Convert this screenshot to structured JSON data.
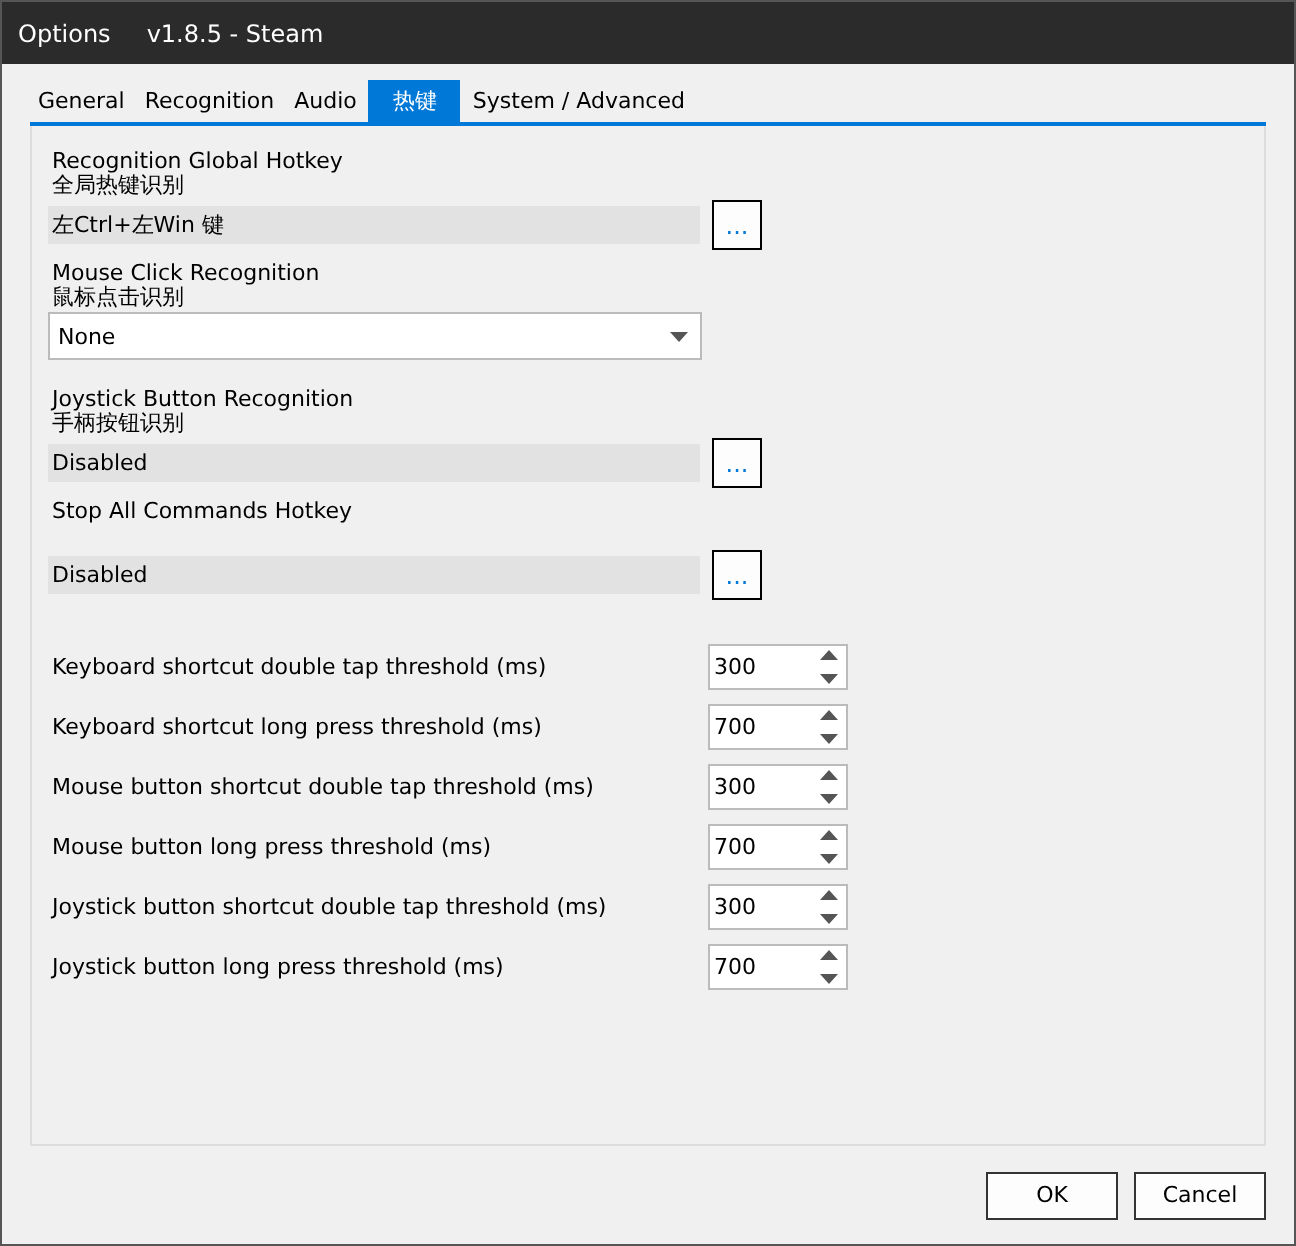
{
  "window": {
    "title": "Options",
    "version": "v1.8.5 - Steam"
  },
  "tabs": [
    {
      "label": "General",
      "selected": false
    },
    {
      "label": "Recognition",
      "selected": false
    },
    {
      "label": "Audio",
      "selected": false
    },
    {
      "label": "热键",
      "selected": true
    },
    {
      "label": "System / Advanced",
      "selected": false
    }
  ],
  "sections": [
    {
      "kind": "hotkey",
      "label": "Recognition Global Hotkey",
      "sublabel": "全局热键识别",
      "value": "左Ctrl+左Win 键",
      "button": "..."
    },
    {
      "kind": "dropdown",
      "label": "Mouse Click Recognition",
      "sublabel": "鼠标点击识别",
      "value": "None"
    },
    {
      "kind": "hotkey",
      "label": "Joystick Button Recognition",
      "sublabel": "手柄按钮识别",
      "value": "Disabled",
      "button": "..."
    },
    {
      "kind": "hotkey",
      "label": "Stop All Commands Hotkey",
      "value": "Disabled",
      "button": "..."
    }
  ],
  "thresholds": [
    {
      "label": "Keyboard shortcut double tap threshold (ms)",
      "value": "300"
    },
    {
      "label": "Keyboard shortcut long press threshold (ms)",
      "value": "700"
    },
    {
      "label": "Mouse button shortcut double tap threshold (ms)",
      "value": "300"
    },
    {
      "label": "Mouse button long press threshold (ms)",
      "value": "700"
    },
    {
      "label": "Joystick button shortcut double tap threshold (ms)",
      "value": "300"
    },
    {
      "label": "Joystick button long press threshold (ms)",
      "value": "700"
    }
  ],
  "buttons": [
    "OK",
    "Cancel"
  ]
}
